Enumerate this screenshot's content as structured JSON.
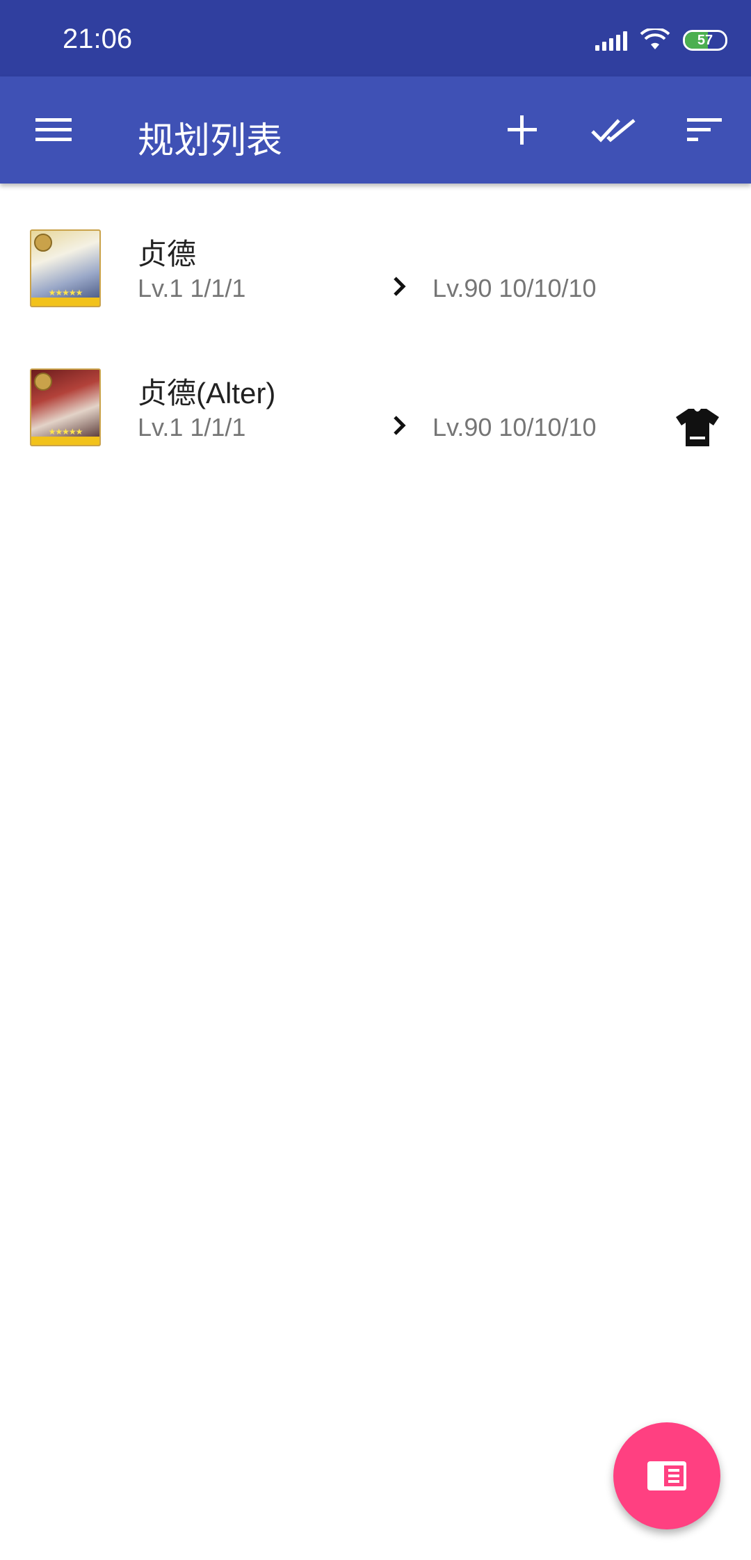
{
  "status_bar": {
    "time": "21:06",
    "battery": "57",
    "battery_level_percent": 57,
    "icons": [
      "signal-icon",
      "wifi-icon",
      "battery-icon"
    ]
  },
  "app_bar": {
    "title": "规划列表",
    "icons": [
      "menu-icon",
      "add-icon",
      "select-all-icon",
      "sort-icon"
    ]
  },
  "servants": [
    {
      "name": "贞德",
      "from_level": "Lv.1 1/1/1",
      "to_level": "Lv.90 10/10/10",
      "stars": "★★★★★",
      "has_costume": false
    },
    {
      "name": "贞德(Alter)",
      "from_level": "Lv.1 1/1/1",
      "to_level": "Lv.90 10/10/10",
      "stars": "★★★★★",
      "has_costume": true
    }
  ],
  "fab": {
    "icon": "list-view-icon"
  },
  "colors": {
    "status_bar": "#303f9f",
    "app_bar": "#3f51b5",
    "fab": "#ff4081"
  }
}
